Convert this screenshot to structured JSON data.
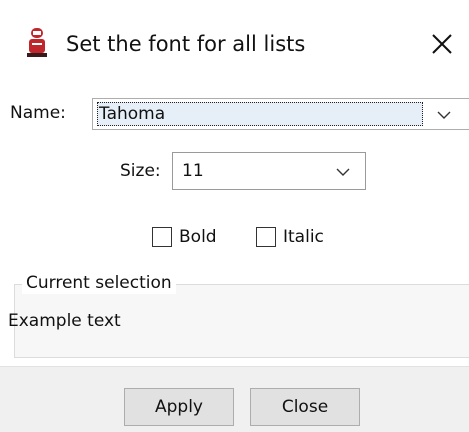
{
  "window": {
    "title": "Set the font for all lists",
    "icon": "app-icon",
    "close_icon": "close-icon"
  },
  "form": {
    "name_label": "Name:",
    "name_value": "Tahoma",
    "size_label": "Size:",
    "size_value": "11",
    "bold_label": "Bold",
    "bold_checked": false,
    "italic_label": "Italic",
    "italic_checked": false
  },
  "preview": {
    "group_title": "Current selection",
    "example_text": "Example text"
  },
  "buttons": {
    "apply_label": "Apply",
    "close_label": "Close"
  },
  "colors": {
    "selection_highlight": "#e6eef8",
    "button_face": "#e1e1e1",
    "footer_bg": "#f0f0f0"
  }
}
